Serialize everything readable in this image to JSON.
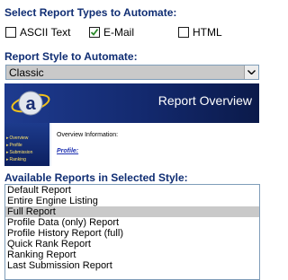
{
  "types_heading": "Select Report Types to Automate:",
  "report_types": [
    {
      "label": "ASCII Text",
      "checked": false
    },
    {
      "label": "E-Mail",
      "checked": true
    },
    {
      "label": "HTML",
      "checked": false
    }
  ],
  "style_heading": "Report Style to Automate:",
  "style_select": {
    "value": "Classic"
  },
  "preview": {
    "title": "Report Overview",
    "nav": [
      "Overview",
      "Profile",
      "Submission",
      "Ranking"
    ],
    "info_text": "Overview Information:",
    "link_text": "Profile:",
    "logo_icon": "a-letter-logo-icon"
  },
  "list_heading": "Available Reports in Selected Style:",
  "reports": [
    "Default Report",
    "Entire Engine Listing",
    "Full Report",
    "Profile Data (only) Report",
    "Profile History Report (full)",
    "Quick Rank Report",
    "Ranking Report",
    "Last Submission Report"
  ],
  "selected_report_index": 2,
  "colors": {
    "heading": "#0f2d73",
    "selection": "#c9c9c9",
    "banner": "#13296e"
  }
}
